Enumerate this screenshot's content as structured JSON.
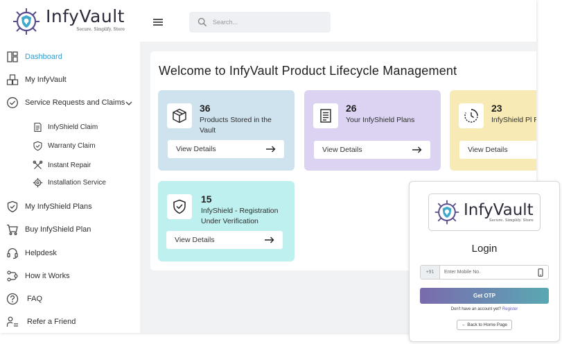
{
  "brand": {
    "name": "InfyVault",
    "tagline": "Secure. Simplify. Store"
  },
  "search": {
    "placeholder": "Search..."
  },
  "sidebar": {
    "items": [
      {
        "label": "Dashboard",
        "icon": "dashboard-icon",
        "active": true
      },
      {
        "label": "My InfyVault",
        "icon": "boxes-icon"
      },
      {
        "label": "Service Requests and Claims",
        "icon": "check-circle-icon"
      },
      {
        "label": "My InfyShield Plans",
        "icon": "shield-check-icon"
      },
      {
        "label": "Buy InfyShield Plan",
        "icon": "cart-icon"
      },
      {
        "label": "Helpdesk",
        "icon": "headset-icon"
      },
      {
        "label": "How it Works",
        "icon": "workflow-icon"
      },
      {
        "label": "FAQ",
        "icon": "question-icon"
      },
      {
        "label": "Refer a Friend",
        "icon": "refer-icon"
      }
    ],
    "sub_items": [
      {
        "label": "InfyShield Claim",
        "icon": "document-icon"
      },
      {
        "label": "Warranty Claim",
        "icon": "shield-icon"
      },
      {
        "label": "Instant Repair",
        "icon": "tools-icon"
      },
      {
        "label": "Installation Service",
        "icon": "gear-icon"
      }
    ]
  },
  "main": {
    "welcome": "Welcome to InfyVault Product Lifecycle Management",
    "cards": [
      {
        "count": "36",
        "desc": "Products Stored in the Vault",
        "button": "View Details",
        "color": "#cfe3ef",
        "icon": "box-icon"
      },
      {
        "count": "26",
        "desc": "Your InfyShield Plans",
        "button": "View Details",
        "color": "#dcd3f3",
        "icon": "list-document-icon"
      },
      {
        "count": "23",
        "desc": "InfyShield Pl Registration",
        "button": "View Details",
        "color": "#f7eab4",
        "icon": "clock-icon"
      },
      {
        "count": "15",
        "desc": "InfyShield - Registration Under Verification",
        "button": "View Details",
        "color": "#bdf0ef",
        "icon": "shield-check-icon"
      }
    ]
  },
  "login": {
    "title": "Login",
    "country_code": "+91",
    "mobile_placeholder": "Enter Mobile No.",
    "otp_button": "Get OTP",
    "register_prompt": "Don't have an account yet?",
    "register_link": "Register",
    "back_button": "← Back to Home Page"
  },
  "colors": {
    "accent": "#2f9bd0",
    "content_bg": "#f1f2f4",
    "otp_gradient_start": "#7a6aae",
    "otp_gradient_end": "#5aa8b3"
  }
}
